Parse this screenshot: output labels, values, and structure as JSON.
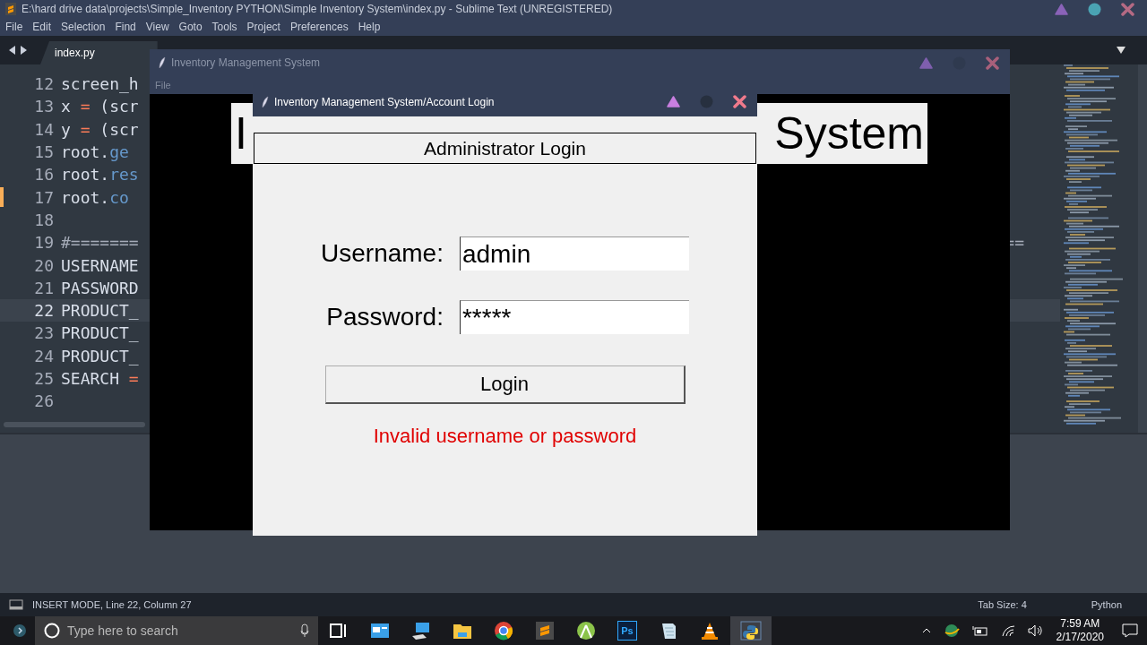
{
  "editor_window": {
    "title": "E:\\hard drive data\\projects\\Simple_Inventory PYTHON\\Simple Inventory System\\index.py - Sublime Text (UNREGISTERED)",
    "menu": [
      "File",
      "Edit",
      "Selection",
      "Find",
      "View",
      "Goto",
      "Tools",
      "Project",
      "Preferences",
      "Help"
    ],
    "tabs": [
      {
        "label": "index.py",
        "selected": true
      }
    ],
    "lines": [
      {
        "number": "12",
        "current": false,
        "modified": false,
        "tokens": [
          {
            "kind": "plain",
            "text": "screen_h"
          }
        ]
      },
      {
        "number": "13",
        "current": false,
        "modified": false,
        "tokens": [
          {
            "kind": "plain",
            "text": "x"
          },
          {
            "kind": "operator",
            "text": " = "
          },
          {
            "kind": "plain",
            "text": "(scr"
          }
        ]
      },
      {
        "number": "14",
        "current": false,
        "modified": false,
        "tokens": [
          {
            "kind": "plain",
            "text": "y"
          },
          {
            "kind": "operator",
            "text": " = "
          },
          {
            "kind": "plain",
            "text": "(scr"
          }
        ]
      },
      {
        "number": "15",
        "current": false,
        "modified": false,
        "tokens": [
          {
            "kind": "plain",
            "text": "root."
          },
          {
            "kind": "method",
            "text": "ge"
          }
        ]
      },
      {
        "number": "16",
        "current": false,
        "modified": false,
        "tokens": [
          {
            "kind": "plain",
            "text": "root."
          },
          {
            "kind": "method",
            "text": "res"
          }
        ]
      },
      {
        "number": "17",
        "current": false,
        "modified": true,
        "tokens": [
          {
            "kind": "plain",
            "text": "root."
          },
          {
            "kind": "method",
            "text": "co"
          }
        ]
      },
      {
        "number": "18",
        "current": false,
        "modified": false
      },
      {
        "number": "19",
        "current": false,
        "modified": false,
        "tokens": [
          {
            "kind": "comment",
            "text": "#======="
          }
        ],
        "tail": "=="
      },
      {
        "number": "20",
        "current": false,
        "modified": false,
        "tokens": [
          {
            "kind": "plain",
            "text": "USERNAME"
          }
        ]
      },
      {
        "number": "21",
        "current": false,
        "modified": false,
        "tokens": [
          {
            "kind": "plain",
            "text": "PASSWORD"
          }
        ]
      },
      {
        "number": "22",
        "current": true,
        "modified": false,
        "tokens": [
          {
            "kind": "plain",
            "text": "PRODUCT_"
          }
        ]
      },
      {
        "number": "23",
        "current": false,
        "modified": false,
        "tokens": [
          {
            "kind": "plain",
            "text": "PRODUCT_"
          }
        ]
      },
      {
        "number": "24",
        "current": false,
        "modified": false,
        "tokens": [
          {
            "kind": "plain",
            "text": "PRODUCT_"
          }
        ]
      },
      {
        "number": "25",
        "current": false,
        "modified": false,
        "tokens": [
          {
            "kind": "plain",
            "text": "SEARCH"
          },
          {
            "kind": "operator",
            "text": " ="
          }
        ]
      },
      {
        "number": "26",
        "current": false,
        "modified": false
      }
    ],
    "status_bar": {
      "mode": "INSERT MODE, Line 22, Column 27",
      "tab_size": "Tab Size: 4",
      "syntax": "Python"
    }
  },
  "main_window": {
    "title": "Inventory Management System",
    "menu": [
      "File"
    ],
    "banner_start": "I",
    "banner_end": "System"
  },
  "login_dialog": {
    "title": "Inventory Management System/Account Login",
    "heading": "Administrator Login",
    "fields": [
      {
        "label": "Username:",
        "value": "admin"
      },
      {
        "label": "Password:",
        "value": "*****"
      }
    ],
    "button": "Login",
    "error": "Invalid username or password"
  },
  "taskbar": {
    "search": {
      "placeholder": "Type here to search"
    },
    "apps": [
      {
        "kind": "taskview",
        "active": false
      },
      {
        "kind": "window",
        "active": false
      },
      {
        "kind": "computer",
        "active": false
      },
      {
        "kind": "folder",
        "active": false
      },
      {
        "kind": "browser",
        "active": false
      },
      {
        "kind": "editor",
        "active": false
      },
      {
        "kind": "robot",
        "active": false
      },
      {
        "kind": "labeled",
        "label": "Ps",
        "active": false
      },
      {
        "kind": "notepad",
        "active": false
      },
      {
        "kind": "cone",
        "active": false
      },
      {
        "kind": "python",
        "active": true
      }
    ],
    "time": "7:59 AM",
    "date": "2/17/2020"
  }
}
